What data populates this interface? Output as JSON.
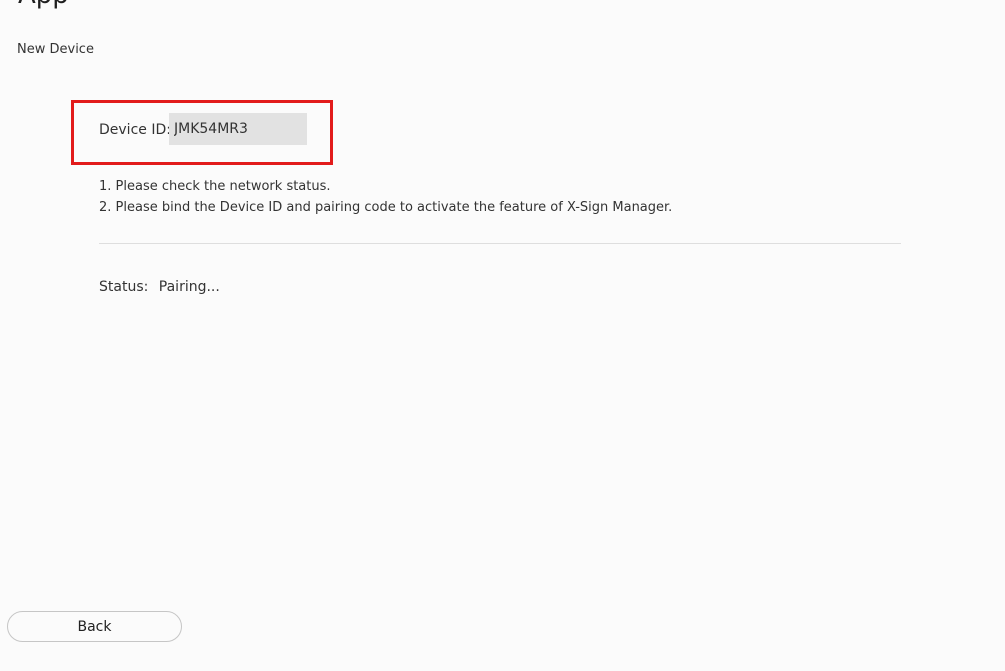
{
  "header": {
    "partial_title": "App",
    "page_title": "New Device"
  },
  "device": {
    "id_label": "Device ID:",
    "id_value": "JMK54MR3"
  },
  "instructions": [
    "1. Please check the network status.",
    "2. Please bind the Device ID and pairing code to activate the feature of X-Sign Manager."
  ],
  "status": {
    "label": "Status:",
    "value": "Pairing..."
  },
  "footer": {
    "back_label": "Back"
  },
  "colors": {
    "highlight": "#e21b1b",
    "field_background": "#e2e2e2",
    "page_background": "#fbfbfb"
  }
}
